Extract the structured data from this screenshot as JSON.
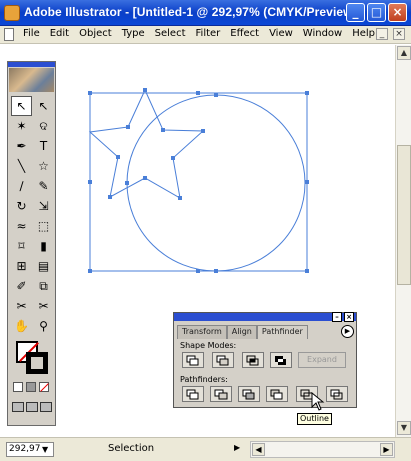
{
  "window": {
    "title": "Adobe Illustrator - [Untitled-1 @ 292,97% (CMYK/Preview)]",
    "minimize_label": "_",
    "maximize_label": "□",
    "close_label": "×"
  },
  "menubar": {
    "items": [
      "File",
      "Edit",
      "Object",
      "Type",
      "Select",
      "Filter",
      "Effect",
      "View",
      "Window",
      "Help"
    ],
    "doc_minimize": "_",
    "doc_close": "×"
  },
  "toolbox": {
    "tools": [
      {
        "name": "selection-tool",
        "glyph": "↖"
      },
      {
        "name": "direct-selection-tool",
        "glyph": "↖"
      },
      {
        "name": "magic-wand-tool",
        "glyph": "✶"
      },
      {
        "name": "lasso-tool",
        "glyph": "ଦ"
      },
      {
        "name": "pen-tool",
        "glyph": "✒"
      },
      {
        "name": "type-tool",
        "glyph": "T"
      },
      {
        "name": "line-segment-tool",
        "glyph": "╲"
      },
      {
        "name": "star-tool",
        "glyph": "☆"
      },
      {
        "name": "paintbrush-tool",
        "glyph": "∕"
      },
      {
        "name": "pencil-tool",
        "glyph": "✎"
      },
      {
        "name": "rotate-tool",
        "glyph": "↻"
      },
      {
        "name": "scale-tool",
        "glyph": "⇲"
      },
      {
        "name": "warp-tool",
        "glyph": "≈"
      },
      {
        "name": "free-transform-tool",
        "glyph": "⬚"
      },
      {
        "name": "symbol-sprayer-tool",
        "glyph": "⌑"
      },
      {
        "name": "column-graph-tool",
        "glyph": "▮"
      },
      {
        "name": "mesh-tool",
        "glyph": "⊞"
      },
      {
        "name": "gradient-tool",
        "glyph": "▤"
      },
      {
        "name": "eyedropper-tool",
        "glyph": "✐"
      },
      {
        "name": "blend-tool",
        "glyph": "⧉"
      },
      {
        "name": "slice-tool",
        "glyph": "✂"
      },
      {
        "name": "scissors-tool",
        "glyph": "✂"
      },
      {
        "name": "hand-tool",
        "glyph": "✋"
      },
      {
        "name": "zoom-tool",
        "glyph": "⚲"
      }
    ]
  },
  "palette": {
    "tabs": [
      "Transform",
      "Align",
      "Pathfinder"
    ],
    "active_tab": "Pathfinder",
    "shape_modes_label": "Shape Modes:",
    "pathfinders_label": "Pathfinders:",
    "expand_label": "Expand",
    "tooltip": "Outline"
  },
  "status": {
    "zoom": "292,97",
    "mode": "Selection"
  },
  "colors": {
    "titlebar": "#0a3fc8",
    "selection": "#4a7fd8",
    "chrome": "#ece9d8",
    "palette_head": "#2b4ed1"
  }
}
